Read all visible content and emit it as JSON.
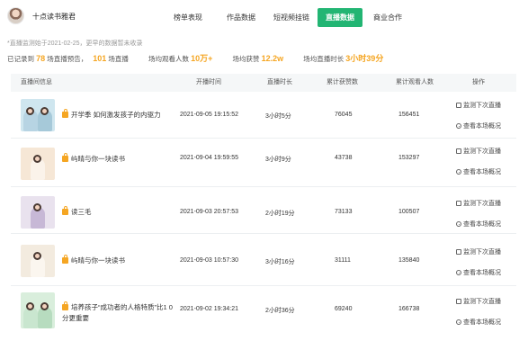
{
  "account": {
    "name": "十点读书雅君"
  },
  "nav": {
    "tabs": [
      "榜单表现",
      "作品数据",
      "短视频挂链",
      "直播数据",
      "商业合作"
    ],
    "active_index": 3
  },
  "note": "*直播监测始于2021-02-25，更早的数据暂未收录",
  "stats": {
    "recorded_prefix": "已记录到",
    "recorded_count": "78",
    "recorded_suffix": "场直播预告，",
    "live_count": "101",
    "live_suffix": "场直播",
    "avg_viewers_label": "场均观看人数",
    "avg_viewers_value": "10万+",
    "avg_likes_label": "场均获赞",
    "avg_likes_value": "12.2w",
    "avg_duration_label": "场均直播时长",
    "avg_duration_value": "3小时39分"
  },
  "table": {
    "headers": [
      "直播间信息",
      "开播时间",
      "直播时长",
      "累计获赞数",
      "累计观看人数",
      "操作"
    ],
    "actions": {
      "monitor": "监测下次直播",
      "overview": "查看本场概况"
    },
    "rows": [
      {
        "title_lines": [
          "开学季 如何激发孩子的内驱力"
        ],
        "start": "2021-09-05 19:15:52",
        "duration": "3小时5分",
        "likes": "76045",
        "viewers": "156451"
      },
      {
        "title_lines": [
          "屿晴与你一块读书"
        ],
        "start": "2021-09-04 19:59:55",
        "duration": "3小时9分",
        "likes": "43738",
        "viewers": "153297"
      },
      {
        "title_lines": [
          "读三毛"
        ],
        "start": "2021-09-03 20:57:53",
        "duration": "2小时19分",
        "likes": "73133",
        "viewers": "100507"
      },
      {
        "title_lines": [
          "屿晴与你一块读书"
        ],
        "start": "2021-09-03 10:57:30",
        "duration": "3小时16分",
        "likes": "31111",
        "viewers": "135840"
      },
      {
        "title_lines": [
          "培养孩子“成功者的人格特质”比1 0",
          "分更重要"
        ],
        "start": "2021-09-02 19:34:21",
        "duration": "2小时36分",
        "likes": "69240",
        "viewers": "166738"
      }
    ]
  }
}
